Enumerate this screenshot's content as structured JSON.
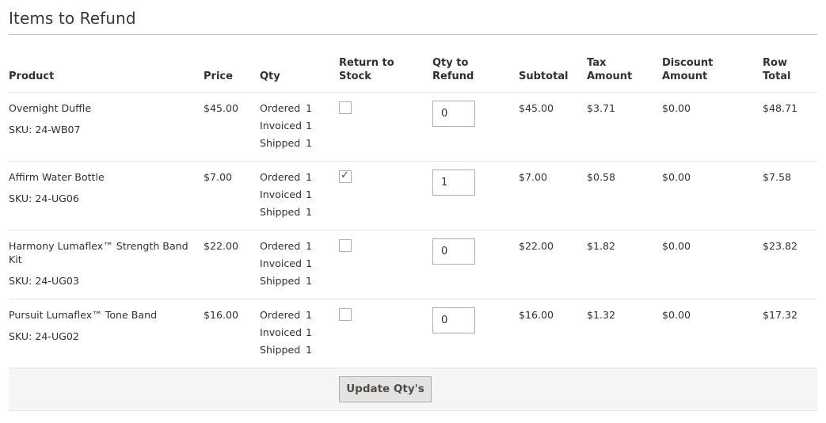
{
  "section": {
    "title": "Items to Refund"
  },
  "columns": {
    "product": "Product",
    "price": "Price",
    "qty": "Qty",
    "return_to_stock_1": "Return to",
    "return_to_stock_2": "Stock",
    "qty_to_refund_1": "Qty to",
    "qty_to_refund_2": "Refund",
    "subtotal": "Subtotal",
    "tax_amount_1": "Tax",
    "tax_amount_2": "Amount",
    "discount_amount_1": "Discount",
    "discount_amount_2": "Amount",
    "row_total_1": "Row",
    "row_total_2": "Total"
  },
  "qty_labels": {
    "ordered": "Ordered",
    "invoiced": "Invoiced",
    "shipped": "Shipped"
  },
  "items": [
    {
      "name": "Overnight Duffle",
      "sku": "SKU: 24-WB07",
      "price": "$45.00",
      "ordered": "1",
      "invoiced": "1",
      "shipped": "1",
      "return_to_stock": false,
      "qty_to_refund": "0",
      "subtotal": "$45.00",
      "tax": "$3.71",
      "discount": "$0.00",
      "row_total": "$48.71"
    },
    {
      "name": "Affirm Water Bottle",
      "sku": "SKU: 24-UG06",
      "price": "$7.00",
      "ordered": "1",
      "invoiced": "1",
      "shipped": "1",
      "return_to_stock": true,
      "qty_to_refund": "1",
      "subtotal": "$7.00",
      "tax": "$0.58",
      "discount": "$0.00",
      "row_total": "$7.58"
    },
    {
      "name": "Harmony Lumaflex™ Strength Band Kit",
      "sku": "SKU: 24-UG03",
      "price": "$22.00",
      "ordered": "1",
      "invoiced": "1",
      "shipped": "1",
      "return_to_stock": false,
      "qty_to_refund": "0",
      "subtotal": "$22.00",
      "tax": "$1.82",
      "discount": "$0.00",
      "row_total": "$23.82"
    },
    {
      "name": "Pursuit Lumaflex™ Tone Band",
      "sku": "SKU: 24-UG02",
      "price": "$16.00",
      "ordered": "1",
      "invoiced": "1",
      "shipped": "1",
      "return_to_stock": false,
      "qty_to_refund": "0",
      "subtotal": "$16.00",
      "tax": "$1.32",
      "discount": "$0.00",
      "row_total": "$17.32"
    }
  ],
  "footer": {
    "update_label": "Update Qty's"
  },
  "icons": {
    "check": "checkmark-icon"
  },
  "colors": {
    "button_bg": "#e3e3e3",
    "footer_bg": "#f5f5f5",
    "text": "#303030"
  }
}
